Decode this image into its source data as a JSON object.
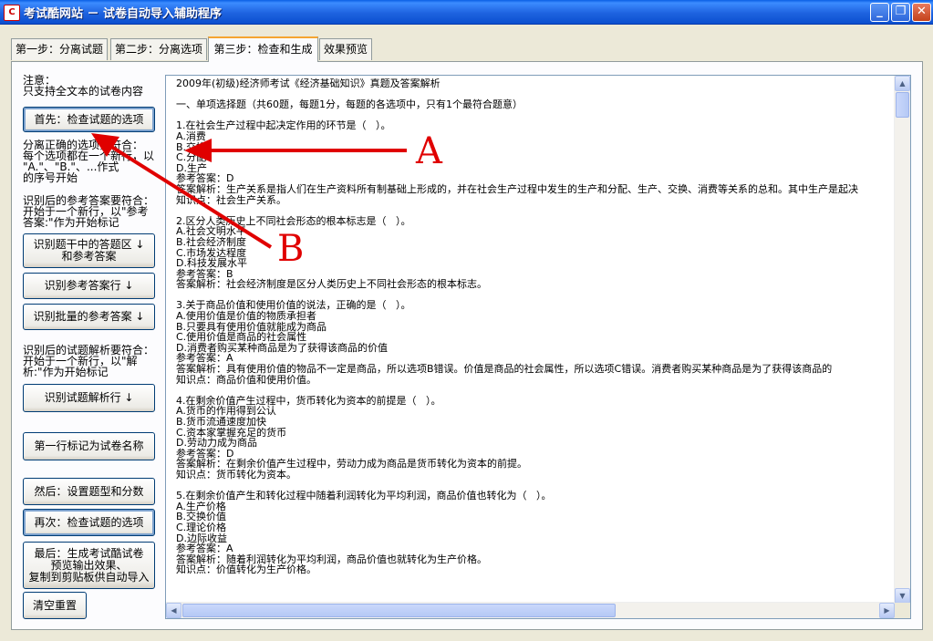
{
  "window": {
    "title": "考试酷网站 － 试卷自动导入辅助程序",
    "icon_text": "C",
    "min_symbol": "_",
    "max_symbol": "❐",
    "close_symbol": "✕"
  },
  "tabs": [
    {
      "label": "第一步：分离试题"
    },
    {
      "label": "第二步：分离选项"
    },
    {
      "label": "第三步：检查和生成"
    },
    {
      "label": "效果预览"
    }
  ],
  "left": {
    "note1_line1": "注意：",
    "note1_line2": "只支持全文本的试卷内容",
    "btn_check_first": "首先：检查试题的选项",
    "note2": [
      "分离正确的选项要符合：",
      "每个选项都在一个新行，以",
      "\"A.\"、\"B.\"、...作式",
      "的序号开始"
    ],
    "note3": [
      "识别后的参考答案要符合：",
      "开始于一个新行，以\"参考",
      "答案:\"作为开始标记"
    ],
    "btn_identify_answer_area": [
      "识别题干中的答题区  ↓",
      "和参考答案"
    ],
    "btn_identify_answer_line": "识别参考答案行  ↓",
    "btn_identify_batch": "识别批量的参考答案  ↓",
    "note4": [
      "识别后的试题解析要符合：",
      "开始于一个新行，以\"解",
      "析:\"作为开始标记"
    ],
    "btn_identify_analysis": "识别试题解析行  ↓",
    "btn_first_line_title": "第一行标记为试卷名称",
    "btn_set_types": "然后：设置题型和分数",
    "btn_check_again": "再次：检查试题的选项",
    "btn_generate": [
      "最后：生成考试酷试卷",
      "预览输出效果、",
      "复制到剪贴板供自动导入"
    ],
    "btn_clear": "清空重置"
  },
  "content_lines": [
    "2009年(初级)经济师考试《经济基础知识》真题及答案解析",
    "",
    "一、单项选择题（共60题，每题1分，每题的各选项中，只有1个最符合题意）",
    "",
    "1.在社会生产过程中起决定作用的环节是（   ）。",
    "A.消费",
    "B.交换",
    "C.分配",
    "D.生产",
    "参考答案：D",
    "答案解析：生产关系是指人们在生产资料所有制基础上形成的，并在社会生产过程中发生的生产和分配、生产、交换、消费等关系的总和。其中生产是起决",
    "知识点：社会生产关系。",
    "",
    "2.区分人类历史上不同社会形态的根本标志是（   ）。",
    "A.社会文明水平",
    "B.社会经济制度",
    "C.市场发达程度",
    "D.科技发展水平",
    "参考答案：B",
    "答案解析：社会经济制度是区分人类历史上不同社会形态的根本标志。",
    "",
    "3.关于商品价值和使用价值的说法，正确的是（   ）。",
    "A.使用价值是价值的物质承担者",
    "B.只要具有使用价值就能成为商品",
    "C.使用价值是商品的社会属性",
    "D.消费者购买某种商品是为了获得该商品的价值",
    "参考答案：A",
    "答案解析：具有使用价值的物品不一定是商品，所以选项B错误。价值是商品的社会属性，所以选项C错误。消费者购买某种商品是为了获得该商品的",
    "知识点：商品价值和使用价值。",
    "",
    "4.在剩余价值产生过程中，货币转化为资本的前提是（   ）。",
    "A.货币的作用得到公认",
    "B.货币流通速度加快",
    "C.资本家掌握充足的货币",
    "D.劳动力成为商品",
    "参考答案：D",
    "答案解析：在剩余价值产生过程中，劳动力成为商品是货币转化为资本的前提。",
    "知识点：货币转化为资本。",
    "",
    "5.在剩余价值产生和转化过程中随着利润转化为平均利润，商品价值也转化为（   ）。",
    "A.生产价格",
    "B.交换价值",
    "C.理论价格",
    "D.边际收益",
    "参考答案：A",
    "答案解析：随着利润转化为平均利润，商品价值也就转化为生产价格。",
    "知识点：价值转化为生产价格。"
  ],
  "scrollbar": {
    "up": "▲",
    "down": "▼",
    "left": "◀",
    "right": "▶"
  },
  "annotations": {
    "label_a": "A",
    "label_b": "B",
    "color": "#E00000"
  }
}
